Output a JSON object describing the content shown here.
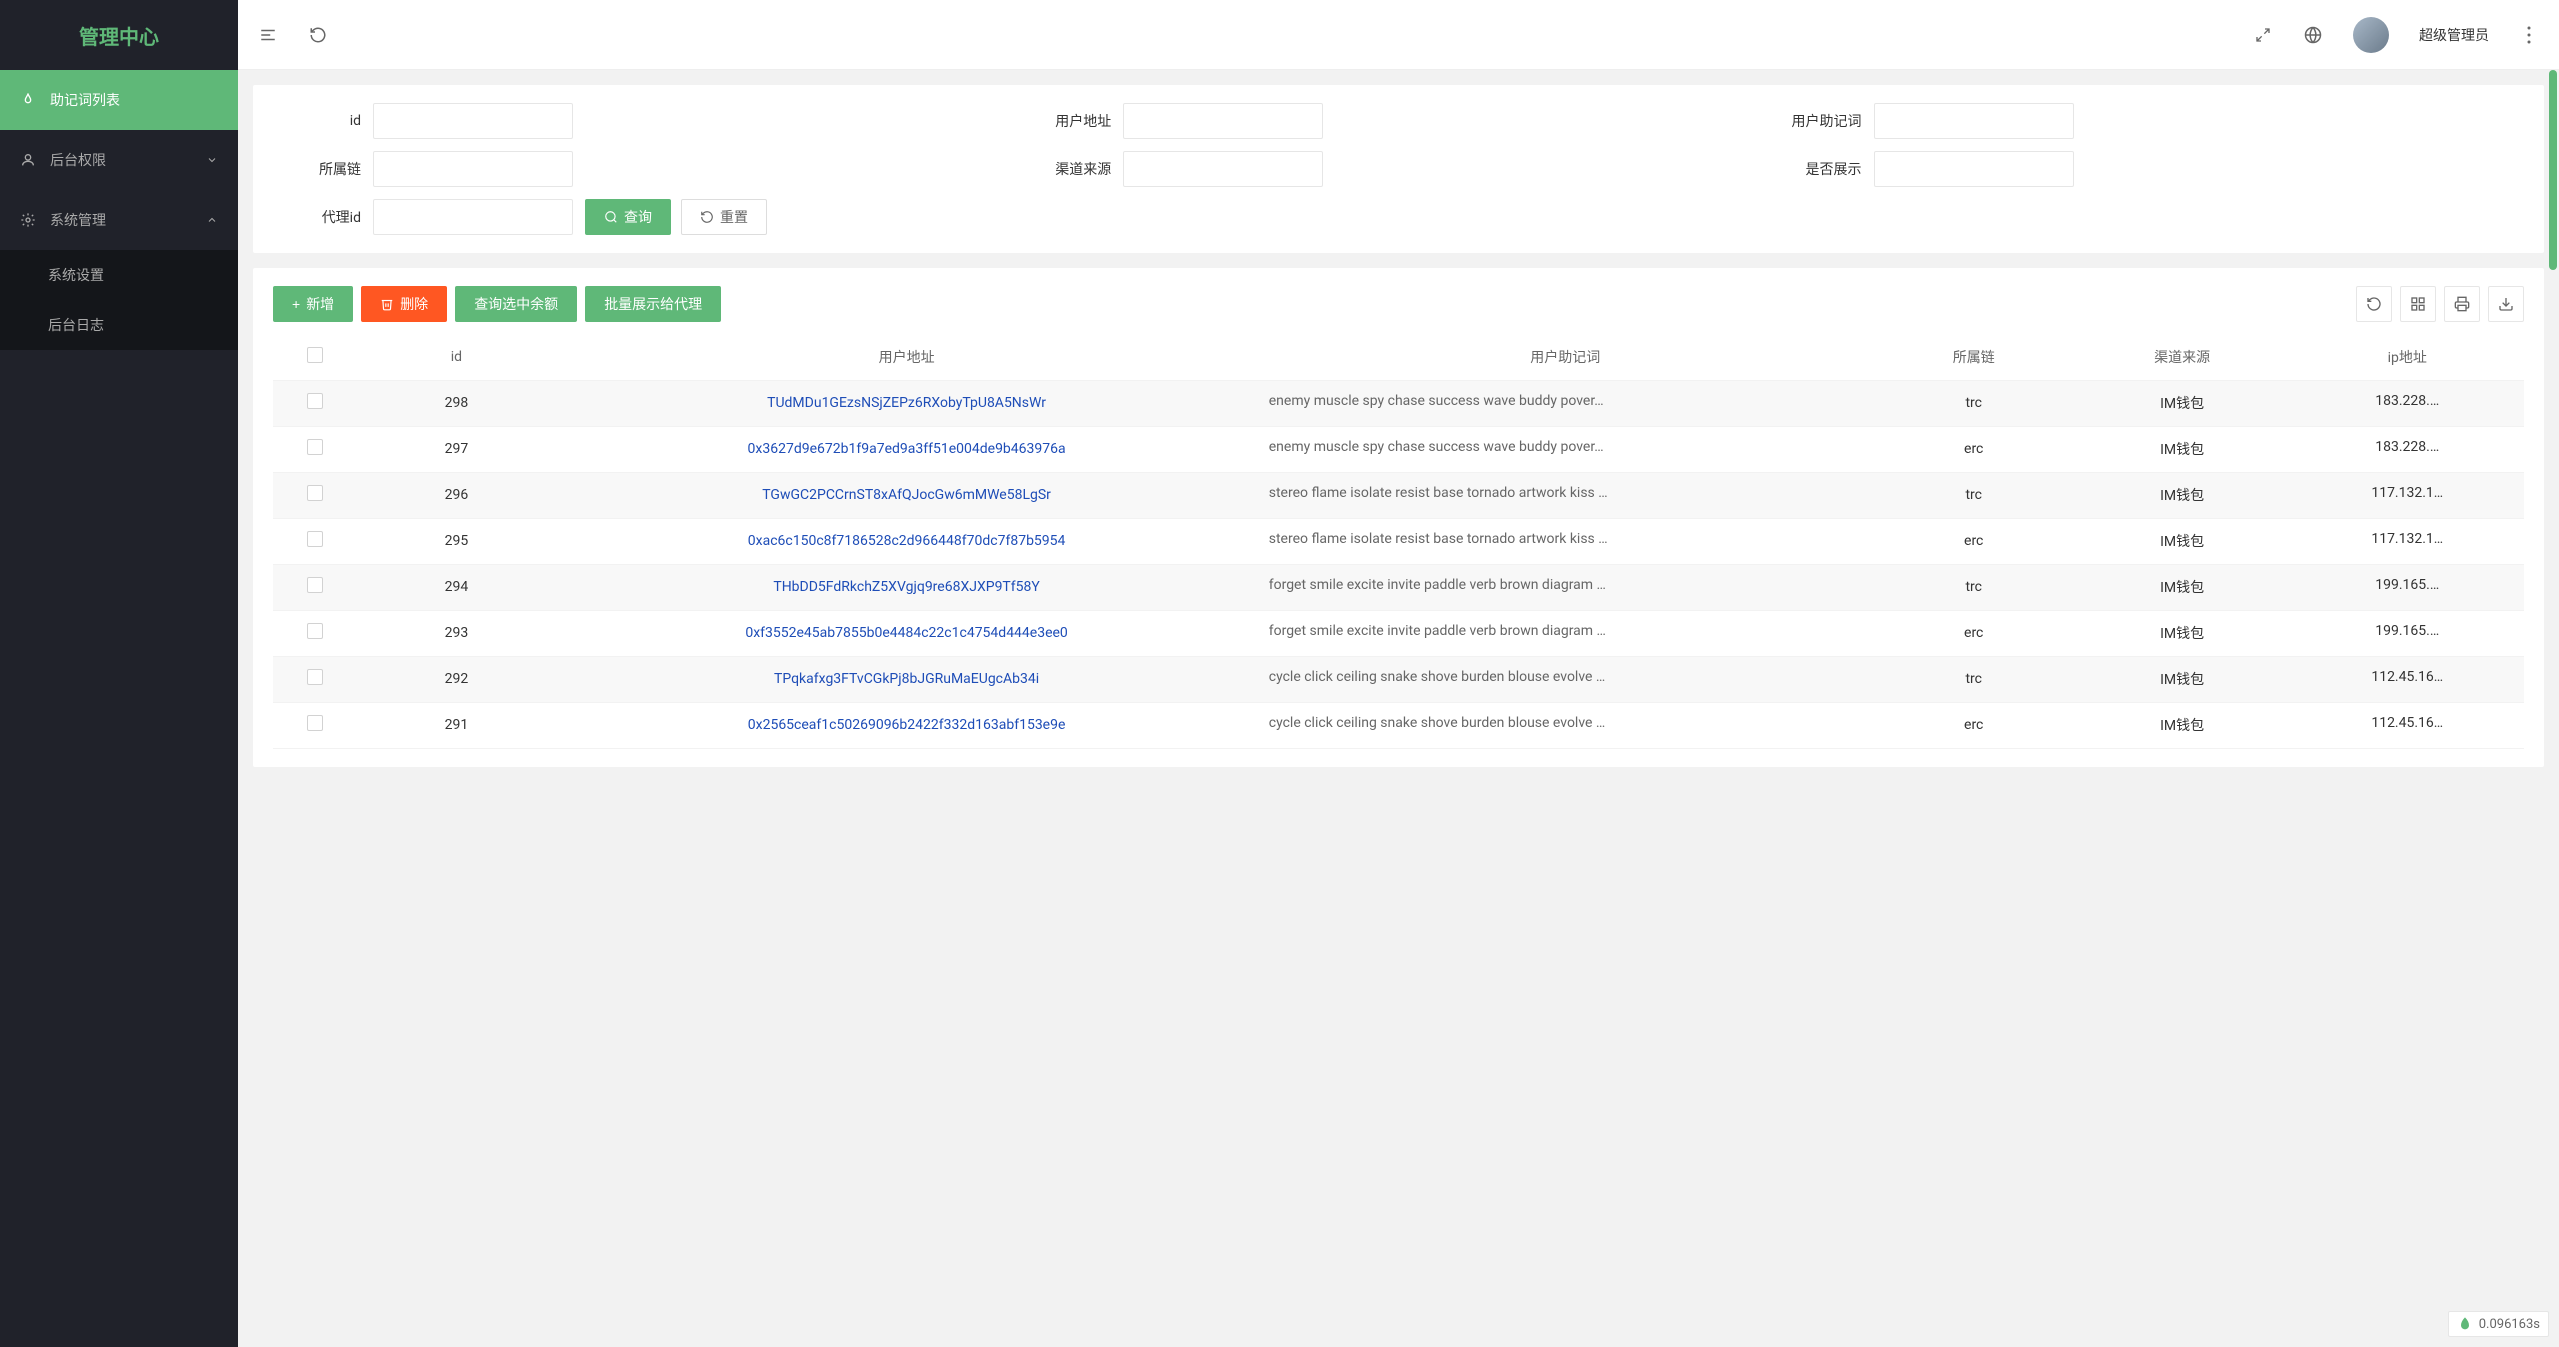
{
  "sidebar": {
    "logo": "管理中心",
    "items": [
      {
        "label": "助记词列表",
        "icon": "fire"
      },
      {
        "label": "后台权限",
        "icon": "user"
      },
      {
        "label": "系统管理",
        "icon": "gear"
      }
    ],
    "submenu": [
      {
        "label": "系统设置"
      },
      {
        "label": "后台日志"
      }
    ]
  },
  "header": {
    "username": "超级管理员"
  },
  "search": {
    "labels": {
      "id": "id",
      "userAddr": "用户地址",
      "mnemonic": "用户助记词",
      "chain": "所属链",
      "channel": "渠道来源",
      "showFlag": "是否展示",
      "agentId": "代理id"
    },
    "queryBtn": "查询",
    "resetBtn": "重置"
  },
  "toolbar": {
    "addBtn": "新增",
    "deleteBtn": "删除",
    "balanceBtn": "查询选中余额",
    "batchShowBtn": "批量展示给代理"
  },
  "table": {
    "headers": {
      "id": "id",
      "userAddr": "用户地址",
      "mnemonic": "用户助记词",
      "chain": "所属链",
      "channel": "渠道来源",
      "ip": "ip地址"
    },
    "rows": [
      {
        "id": "298",
        "addr": "TUdMDu1GEzsNSjZEPz6RXobyTpU8A5NsWr",
        "mnemonic": "enemy muscle spy chase success wave buddy pover…",
        "chain": "trc",
        "channel": "IM钱包",
        "ip": "183.228.…"
      },
      {
        "id": "297",
        "addr": "0x3627d9e672b1f9a7ed9a3ff51e004de9b463976a",
        "mnemonic": "enemy muscle spy chase success wave buddy pover…",
        "chain": "erc",
        "channel": "IM钱包",
        "ip": "183.228.…"
      },
      {
        "id": "296",
        "addr": "TGwGC2PCCrnST8xAfQJocGw6mMWe58LgSr",
        "mnemonic": "stereo flame isolate resist base tornado artwork kiss …",
        "chain": "trc",
        "channel": "IM钱包",
        "ip": "117.132.1…"
      },
      {
        "id": "295",
        "addr": "0xac6c150c8f7186528c2d966448f70dc7f87b5954",
        "mnemonic": "stereo flame isolate resist base tornado artwork kiss …",
        "chain": "erc",
        "channel": "IM钱包",
        "ip": "117.132.1…"
      },
      {
        "id": "294",
        "addr": "THbDD5FdRkchZ5XVgjq9re68XJXP9Tf58Y",
        "mnemonic": "forget smile excite invite paddle verb brown diagram …",
        "chain": "trc",
        "channel": "IM钱包",
        "ip": "199.165.…"
      },
      {
        "id": "293",
        "addr": "0xf3552e45ab7855b0e4484c22c1c4754d444e3ee0",
        "mnemonic": "forget smile excite invite paddle verb brown diagram …",
        "chain": "erc",
        "channel": "IM钱包",
        "ip": "199.165.…"
      },
      {
        "id": "292",
        "addr": "TPqkafxg3FTvCGkPj8bJGRuMaEUgcAb34i",
        "mnemonic": "cycle click ceiling snake shove burden blouse evolve …",
        "chain": "trc",
        "channel": "IM钱包",
        "ip": "112.45.16…"
      },
      {
        "id": "291",
        "addr": "0x2565ceaf1c50269096b2422f332d163abf153e9e",
        "mnemonic": "cycle click ceiling snake shove burden blouse evolve …",
        "chain": "erc",
        "channel": "IM钱包",
        "ip": "112.45.16…"
      }
    ]
  },
  "timer": "0.096163s"
}
